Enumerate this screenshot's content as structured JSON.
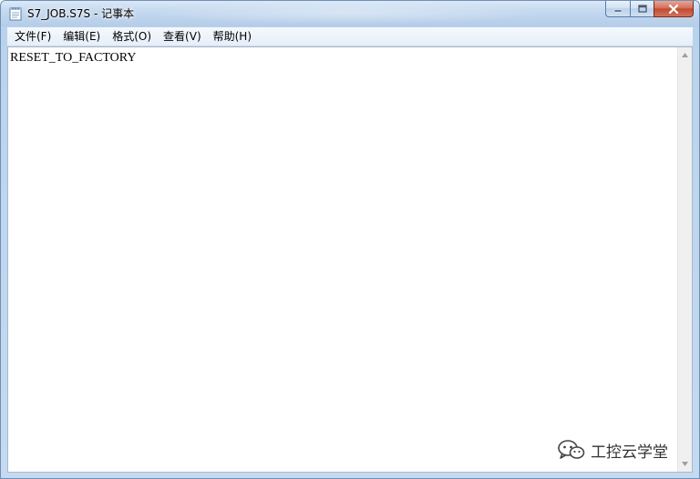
{
  "window": {
    "title": "S7_JOB.S7S - 记事本"
  },
  "menu": {
    "items": [
      {
        "label": "文件(F)"
      },
      {
        "label": "编辑(E)"
      },
      {
        "label": "格式(O)"
      },
      {
        "label": "查看(V)"
      },
      {
        "label": "帮助(H)"
      }
    ]
  },
  "editor": {
    "content": "RESET_TO_FACTORY"
  },
  "watermark": {
    "text": "工控云学堂"
  },
  "icons": {
    "app": "notepad-icon",
    "minimize": "minimize-icon",
    "maximize": "maximize-icon",
    "close": "close-icon",
    "scroll_up": "scroll-up-arrow-icon",
    "scroll_down": "scroll-down-arrow-icon",
    "watermark": "wechat-icon"
  },
  "colors": {
    "titlebar": "#c5daf0",
    "close_button": "#c24a32",
    "editor_bg": "#ffffff"
  }
}
